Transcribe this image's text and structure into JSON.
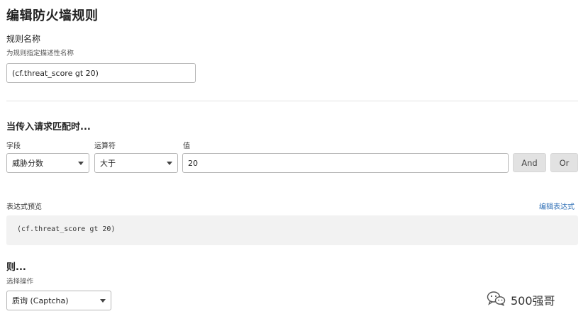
{
  "page": {
    "title": "编辑防火墙规则"
  },
  "rule_name": {
    "label": "规则名称",
    "help": "为规则指定描述性名称",
    "value": "(cf.threat_score gt 20)"
  },
  "match": {
    "heading": "当传入请求匹配时...",
    "field_label": "字段",
    "operator_label": "运算符",
    "value_label": "值",
    "field_value": "威胁分数",
    "operator_value": "大于",
    "value_value": "20",
    "and_label": "And",
    "or_label": "Or"
  },
  "expression": {
    "label": "表达式预览",
    "edit_link": "编辑表达式",
    "code": "(cf.threat_score gt 20)"
  },
  "then": {
    "heading": "则...",
    "action_label": "选择操作",
    "action_value": "质询 (Captcha)"
  },
  "watermark": {
    "text": "500强哥",
    "icon": "wechat-icon"
  }
}
